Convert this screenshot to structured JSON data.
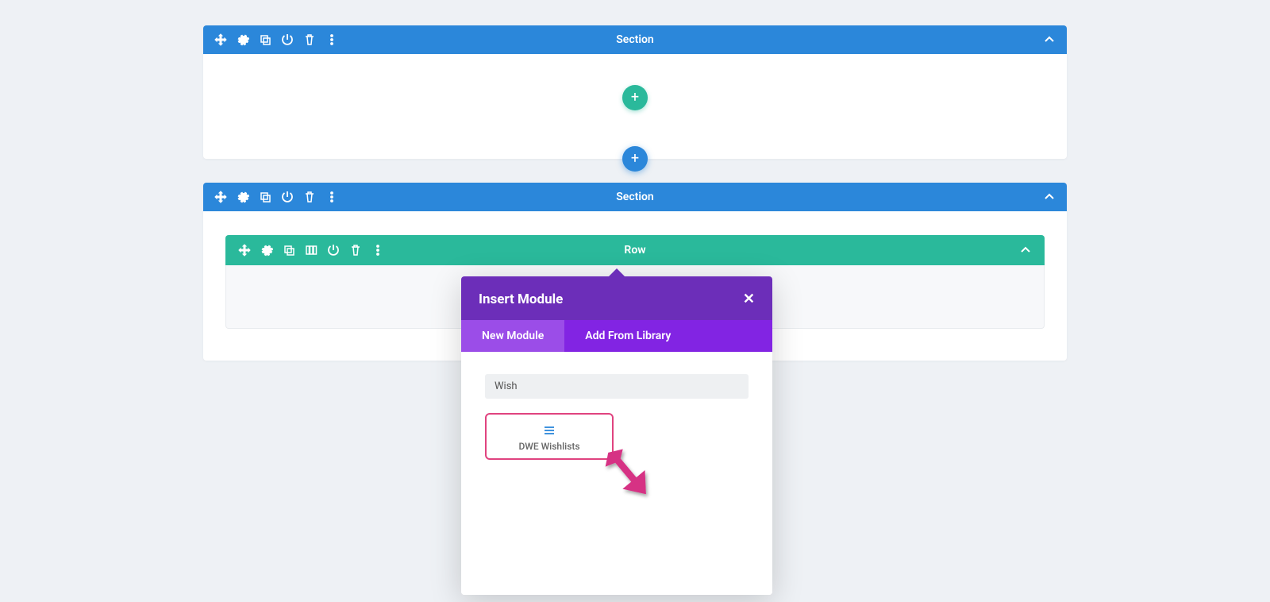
{
  "sections": [
    {
      "title": "Section"
    },
    {
      "title": "Section"
    }
  ],
  "row": {
    "title": "Row"
  },
  "modal": {
    "title": "Insert Module",
    "close": "✕",
    "tabs": {
      "new": "New Module",
      "library": "Add From Library"
    },
    "search_value": "Wish",
    "module_label": "DWE Wishlists"
  }
}
